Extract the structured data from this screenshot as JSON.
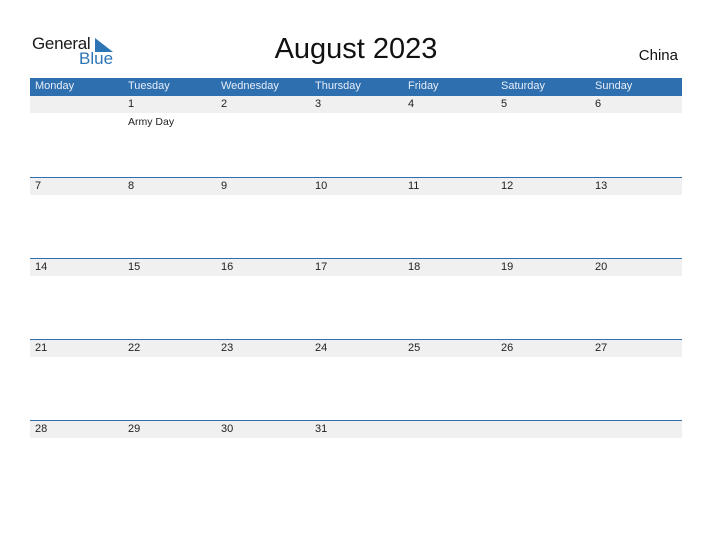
{
  "logo": {
    "text_general": "General",
    "text_blue": "Blue",
    "icon": "triangle-flag-icon"
  },
  "title": "August 2023",
  "country": "China",
  "colors": {
    "accent": "#2e6fb0",
    "strip": "#f0f0f0"
  },
  "weekdays": [
    "Monday",
    "Tuesday",
    "Wednesday",
    "Thursday",
    "Friday",
    "Saturday",
    "Sunday"
  ],
  "weeks": [
    {
      "days": [
        "",
        "1",
        "2",
        "3",
        "4",
        "5",
        "6"
      ],
      "holidays": [
        "",
        "Army Day",
        "",
        "",
        "",
        "",
        ""
      ]
    },
    {
      "days": [
        "7",
        "8",
        "9",
        "10",
        "11",
        "12",
        "13"
      ],
      "holidays": [
        "",
        "",
        "",
        "",
        "",
        "",
        ""
      ]
    },
    {
      "days": [
        "14",
        "15",
        "16",
        "17",
        "18",
        "19",
        "20"
      ],
      "holidays": [
        "",
        "",
        "",
        "",
        "",
        "",
        ""
      ]
    },
    {
      "days": [
        "21",
        "22",
        "23",
        "24",
        "25",
        "26",
        "27"
      ],
      "holidays": [
        "",
        "",
        "",
        "",
        "",
        "",
        ""
      ]
    },
    {
      "days": [
        "28",
        "29",
        "30",
        "31",
        "",
        "",
        ""
      ],
      "holidays": [
        "",
        "",
        "",
        "",
        "",
        "",
        ""
      ]
    }
  ]
}
